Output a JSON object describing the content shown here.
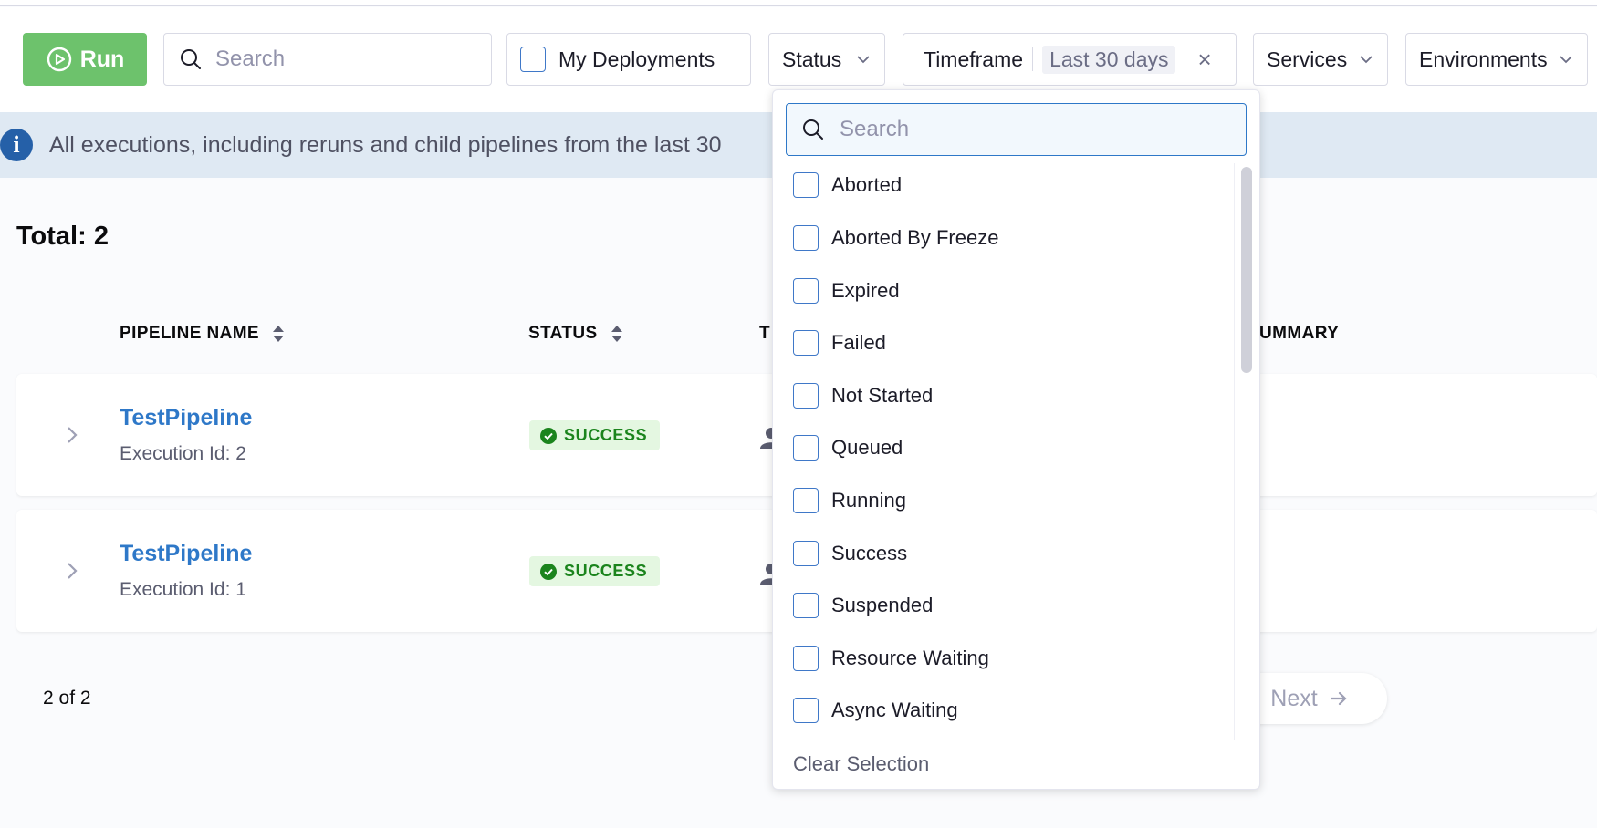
{
  "toolbar": {
    "run_label": "Run",
    "search_placeholder": "Search",
    "my_deployments_label": "My Deployments",
    "status_label": "Status",
    "timeframe_label": "Timeframe",
    "timeframe_value": "Last 30 days",
    "timeframe_clear": "×",
    "services_label": "Services",
    "environments_label": "Environments"
  },
  "banner": {
    "icon": "i",
    "text": "All executions, including reruns and child pipelines from the last 30"
  },
  "total_label": "Total: 2",
  "table": {
    "headers": {
      "pipeline_name": "PIPELINE NAME",
      "status": "STATUS",
      "trigger_partial": "T",
      "summary_partial": "UMMARY"
    },
    "rows": [
      {
        "name": "TestPipeline",
        "execution": "Execution Id: 2",
        "status": "SUCCESS"
      },
      {
        "name": "TestPipeline",
        "execution": "Execution Id: 1",
        "status": "SUCCESS"
      }
    ]
  },
  "pagination": {
    "count": "2 of 2",
    "next_label": "Next"
  },
  "status_dropdown": {
    "search_placeholder": "Search",
    "options": [
      "Aborted",
      "Aborted By Freeze",
      "Expired",
      "Failed",
      "Not Started",
      "Queued",
      "Running",
      "Success",
      "Suspended",
      "Resource Waiting",
      "Async Waiting"
    ],
    "clear_label": "Clear Selection"
  },
  "colors": {
    "run_button": "#6dc26c",
    "link": "#2e78c8",
    "success_bg": "#e4f7e1",
    "success_text": "#1b841d",
    "banner_bg": "#dfe9f3",
    "checkbox_border": "#3f78c8"
  }
}
